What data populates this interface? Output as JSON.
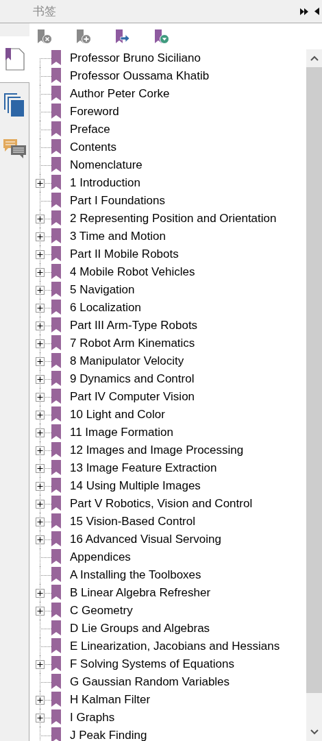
{
  "panel": {
    "title": "书签"
  },
  "side_tabs": [
    {
      "kind": "page",
      "selected": true
    },
    {
      "kind": "pages",
      "selected": false
    },
    {
      "kind": "comments",
      "selected": false
    }
  ],
  "toolbar": [
    {
      "kind": "delete"
    },
    {
      "kind": "add"
    },
    {
      "kind": "goto"
    },
    {
      "kind": "options"
    }
  ],
  "bookmarks": [
    {
      "label": "Professor Bruno Siciliano",
      "expandable": false
    },
    {
      "label": "Professor Oussama Khatib",
      "expandable": false
    },
    {
      "label": "Author Peter Corke",
      "expandable": false
    },
    {
      "label": "Foreword",
      "expandable": false
    },
    {
      "label": "Preface",
      "expandable": false
    },
    {
      "label": "Contents",
      "expandable": false
    },
    {
      "label": "Nomenclature",
      "expandable": false
    },
    {
      "label": "1 Introduction",
      "expandable": true
    },
    {
      "label": "Part I Foundations",
      "expandable": false
    },
    {
      "label": "2 Representing Position and Orientation",
      "expandable": true
    },
    {
      "label": "3 Time and Motion",
      "expandable": true
    },
    {
      "label": "Part II Mobile Robots",
      "expandable": true
    },
    {
      "label": "4 Mobile Robot Vehicles",
      "expandable": true
    },
    {
      "label": "5 Navigation",
      "expandable": true
    },
    {
      "label": "6 Localization",
      "expandable": true
    },
    {
      "label": "Part III Arm-Type Robots",
      "expandable": true
    },
    {
      "label": "7 Robot Arm Kinematics",
      "expandable": true
    },
    {
      "label": "8 Manipulator Velocity",
      "expandable": true
    },
    {
      "label": "9 Dynamics and Control",
      "expandable": true
    },
    {
      "label": "Part IV Computer Vision",
      "expandable": true
    },
    {
      "label": "10 Light and Color",
      "expandable": true
    },
    {
      "label": "11 Image Formation",
      "expandable": true
    },
    {
      "label": "12 Images and Image Processing",
      "expandable": true
    },
    {
      "label": "13 Image Feature Extraction",
      "expandable": true
    },
    {
      "label": "14 Using Multiple Images",
      "expandable": true
    },
    {
      "label": "Part V Robotics, Vision and Control",
      "expandable": true
    },
    {
      "label": "15 Vision-Based Control",
      "expandable": true
    },
    {
      "label": "16 Advanced Visual Servoing",
      "expandable": true
    },
    {
      "label": "Appendices",
      "expandable": false
    },
    {
      "label": "A Installing the Toolboxes",
      "expandable": false
    },
    {
      "label": "B Linear Algebra Refresher",
      "expandable": true
    },
    {
      "label": "C Geometry",
      "expandable": true
    },
    {
      "label": "D Lie Groups and Algebras",
      "expandable": false
    },
    {
      "label": "E Linearization, Jacobians and Hessians",
      "expandable": false
    },
    {
      "label": "F Solving Systems of Equations",
      "expandable": true
    },
    {
      "label": "G Gaussian Random Variables",
      "expandable": false
    },
    {
      "label": "H Kalman Filter",
      "expandable": true
    },
    {
      "label": "I Graphs",
      "expandable": true
    },
    {
      "label": "J Peak Finding",
      "expandable": false
    }
  ]
}
